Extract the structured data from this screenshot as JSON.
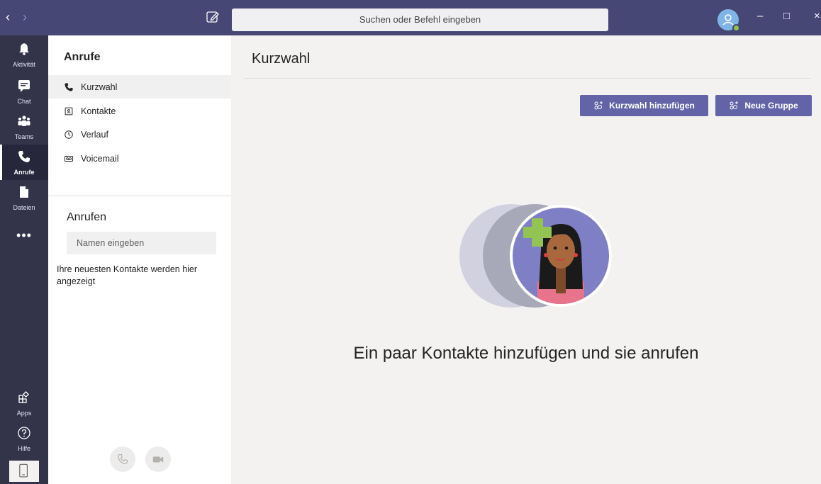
{
  "titlebar": {
    "back_glyph": "‹",
    "forward_glyph": "›",
    "search_text": "Suchen oder Befehl eingeben",
    "minimize_glyph": "–",
    "maximize_glyph": "□",
    "close_glyph": "×"
  },
  "rail": {
    "items": [
      {
        "label": "Aktivität",
        "icon": "bell-icon"
      },
      {
        "label": "Chat",
        "icon": "chat-icon"
      },
      {
        "label": "Teams",
        "icon": "teams-icon"
      },
      {
        "label": "Anrufe",
        "icon": "phone-icon"
      },
      {
        "label": "Dateien",
        "icon": "file-icon"
      }
    ],
    "more_glyph": "•••",
    "apps_label": "Apps",
    "help_label": "Hilfe"
  },
  "panel": {
    "title": "Anrufe",
    "items": [
      {
        "label": "Kurzwahl",
        "icon": "phone-icon"
      },
      {
        "label": "Kontakte",
        "icon": "contact-card-icon"
      },
      {
        "label": "Verlauf",
        "icon": "clock-icon"
      },
      {
        "label": "Voicemail",
        "icon": "voicemail-icon"
      }
    ],
    "call_title": "Anrufen",
    "name_placeholder": "Namen eingeben",
    "hint": "Ihre neuesten Kontakte werden hier angezeigt"
  },
  "main": {
    "title": "Kurzwahl",
    "add_speed_dial_label": "Kurzwahl hinzufügen",
    "new_group_label": "Neue Gruppe",
    "empty_message": "Ein paar Kontakte hinzufügen und sie anrufen"
  },
  "colors": {
    "brand": "#6264a7",
    "titlebar": "#464775",
    "rail": "#33344a",
    "presence": "#92c353"
  }
}
